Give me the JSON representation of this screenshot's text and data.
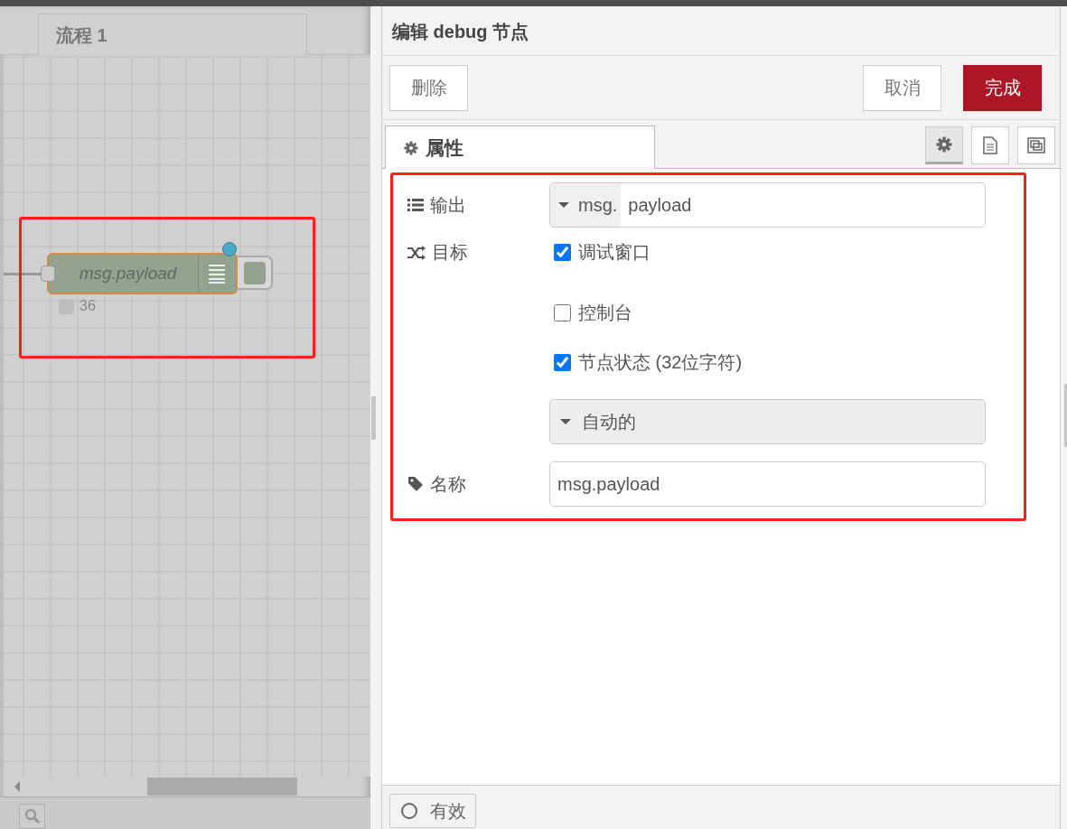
{
  "canvas": {
    "tab": "流程 1",
    "node": {
      "label": "msg.payload",
      "status": "36",
      "selected": true,
      "changed": true
    }
  },
  "editor": {
    "title": "编辑 debug 节点",
    "buttons": {
      "delete": "删除",
      "cancel": "取消",
      "done": "完成"
    },
    "tabs": [
      {
        "label": "属性",
        "selected": true
      }
    ],
    "side_tabs": [
      {
        "kind": "settings",
        "selected": true
      },
      {
        "kind": "description",
        "selected": false
      },
      {
        "kind": "appearance",
        "selected": false
      }
    ],
    "form": {
      "output": {
        "label": "输出",
        "prefix": "msg.",
        "value": "payload"
      },
      "target": {
        "label": "目标",
        "options": [
          {
            "label": "调试窗口",
            "checked": true
          },
          {
            "label": "控制台",
            "checked": false
          },
          {
            "label": "节点状态 (32位字符)",
            "checked": true
          }
        ]
      },
      "status_mode": "自动的",
      "name": {
        "label": "名称",
        "value": "msg.payload"
      }
    },
    "footer": {
      "enabled": "有效"
    }
  }
}
